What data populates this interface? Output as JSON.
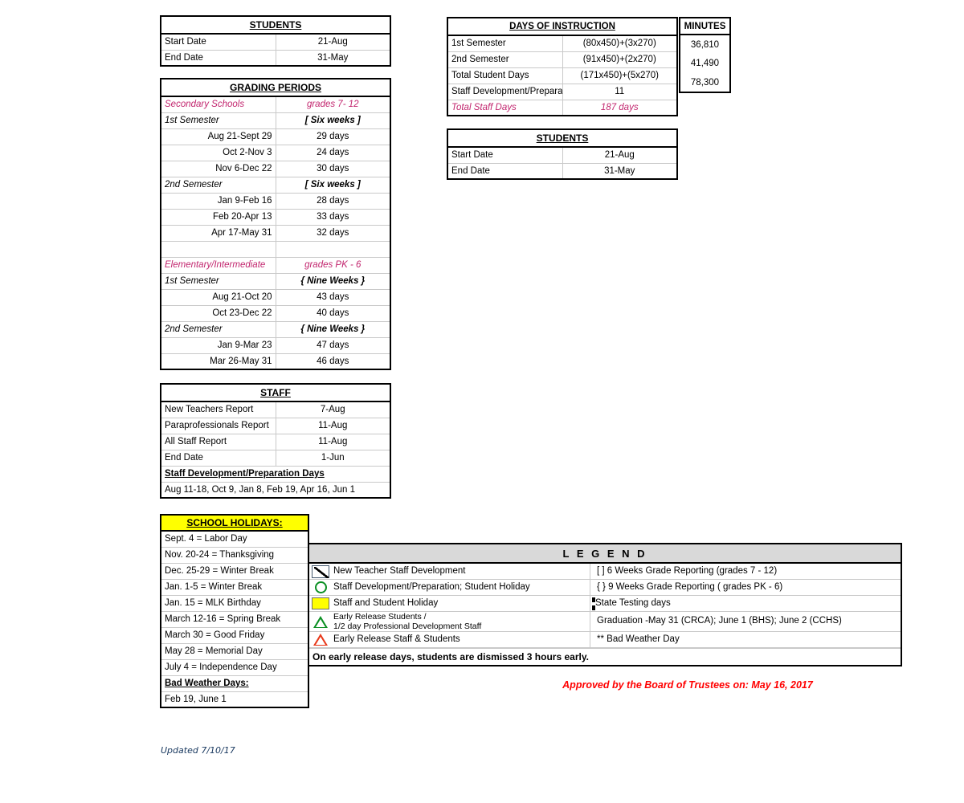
{
  "students_left": {
    "title": "STUDENTS",
    "rows": [
      {
        "label": "Start Date",
        "value": "21-Aug"
      },
      {
        "label": "End Date",
        "value": "31-May"
      }
    ]
  },
  "grading_periods": {
    "title": "GRADING PERIODS",
    "rows": [
      {
        "label": "Secondary Schools",
        "value": "grades 7- 12",
        "style": "pink"
      },
      {
        "label": "1st Semester",
        "value": "[ Six weeks ]",
        "style": "ital"
      },
      {
        "label": "Aug 21-Sept 29",
        "value": "29 days",
        "style": "right"
      },
      {
        "label": "Oct 2-Nov 3",
        "value": "24 days",
        "style": "right"
      },
      {
        "label": "Nov 6-Dec 22",
        "value": "30 days",
        "style": "right"
      },
      {
        "label": "2nd Semester",
        "value": "[ Six weeks ]",
        "style": "ital"
      },
      {
        "label": "Jan 9-Feb 16",
        "value": "28 days",
        "style": "right"
      },
      {
        "label": "Feb 20-Apr 13",
        "value": "33 days",
        "style": "right"
      },
      {
        "label": "Apr 17-May 31",
        "value": "32 days",
        "style": "right"
      },
      {
        "label": "",
        "value": "",
        "style": "blank"
      },
      {
        "label": "Elementary/Intermediate",
        "value": "grades PK - 6",
        "style": "pink"
      },
      {
        "label": "1st Semester",
        "value": "{ Nine Weeks }",
        "style": "ital"
      },
      {
        "label": "Aug 21-Oct 20",
        "value": "43 days",
        "style": "right"
      },
      {
        "label": "Oct 23-Dec 22",
        "value": "40 days",
        "style": "right"
      },
      {
        "label": "2nd Semester",
        "value": "{ Nine Weeks }",
        "style": "ital"
      },
      {
        "label": "Jan 9-Mar 23",
        "value": "47 days",
        "style": "right"
      },
      {
        "label": "Mar 26-May 31",
        "value": "46 days",
        "style": "right"
      }
    ]
  },
  "staff": {
    "title": "STAFF",
    "rows": [
      {
        "label": "New Teachers Report",
        "value": "7-Aug"
      },
      {
        "label": "Paraprofessionals Report",
        "value": "11-Aug"
      },
      {
        "label": "All Staff Report",
        "value": "11-Aug"
      },
      {
        "label": "End Date",
        "value": "1-Jun"
      }
    ],
    "dev_heading": "Staff Development/Preparation Days",
    "dev_dates": "Aug 11-18, Oct 9, Jan 8, Feb 19, Apr 16, Jun 1"
  },
  "holidays": {
    "title": "SCHOOL HOLIDAYS:",
    "items": [
      "Sept. 4 = Labor Day",
      "Nov. 20-24 = Thanksgiving",
      "Dec. 25-29 = Winter Break",
      "Jan. 1-5 = Winter Break",
      "Jan. 15 = MLK Birthday",
      "March 12-16 = Spring Break",
      "March 30  = Good Friday",
      "May 28 = Memorial Day",
      "July 4 = Independence Day"
    ],
    "bad_weather_heading": "Bad Weather Days:",
    "bad_weather_dates": "Feb 19, June 1"
  },
  "days_of_instruction": {
    "title": "DAYS OF INSTRUCTION",
    "rows": [
      {
        "label": "1st Semester",
        "value": "(80x450)+(3x270)",
        "style": ""
      },
      {
        "label": "2nd Semester",
        "value": "(91x450)+(2x270)",
        "style": ""
      },
      {
        "label": "Total Student Days",
        "value": "(171x450)+(5x270)",
        "style": ""
      },
      {
        "label": "Staff Development/Preparation",
        "value": "11",
        "style": ""
      },
      {
        "label": "Total Staff Days",
        "value": "187 days",
        "style": "pink"
      }
    ]
  },
  "minutes": {
    "title": "MINUTES",
    "values": [
      "36,810",
      "41,490",
      "78,300"
    ]
  },
  "students_right": {
    "title": "STUDENTS",
    "rows": [
      {
        "label": "Start Date",
        "value": "21-Aug"
      },
      {
        "label": "End Date",
        "value": "31-May"
      }
    ]
  },
  "legend": {
    "title": "L E G E N D",
    "left_items": [
      {
        "icon": "box-with-slash-icon",
        "text": "New Teacher Staff Development"
      },
      {
        "icon": "green-circle-icon",
        "text": "Staff Development/Preparation; Student Holiday"
      },
      {
        "icon": "yellow-square-icon",
        "text": "Staff and Student Holiday"
      },
      {
        "icon": "green-triangle-icon",
        "text": "Early Release Students /",
        "text2": "1/2 day Professional Development Staff"
      },
      {
        "icon": "red-triangle-icon",
        "text": "Early Release Staff & Students"
      }
    ],
    "right_items": [
      {
        "icon": "",
        "text": "[ ] 6 Weeks Grade Reporting (grades 7 - 12)"
      },
      {
        "icon": "",
        "text": "{ } 9 Weeks Grade Reporting ( grades PK - 6)"
      },
      {
        "icon": "dashed-box-icon",
        "text": "State Testing days"
      },
      {
        "icon": "",
        "text": "Graduation -May 31 (CRCA); June 1 (BHS); June 2 (CCHS)"
      },
      {
        "icon": "",
        "text": "** Bad Weather Day"
      }
    ],
    "footer": "On early release days, students are dismissed 3 hours early."
  },
  "approved_note": "Approved by the Board of Trustees on: May 16, 2017",
  "updated_note": "Updated 7/10/17",
  "colors": {
    "accent_pink": "#c2256e",
    "approved_red": "#ff0000",
    "holiday_yellow": "#ffff00",
    "legend_header_gray": "#d9d9d9",
    "green": "#0a8f22",
    "red": "#e8391a"
  }
}
